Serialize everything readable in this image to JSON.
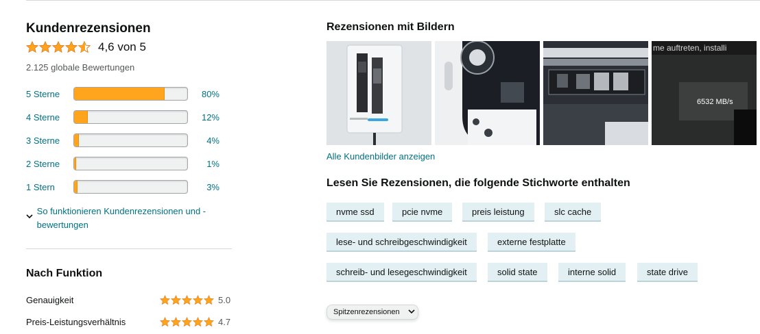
{
  "ratings": {
    "title": "Kundenrezensionen",
    "average_text": "4,6 von 5",
    "average_value": 4.6,
    "global_count": "2.125 globale Bewertungen",
    "histogram": [
      {
        "label": "5 Sterne",
        "percent": "80%",
        "value": 80
      },
      {
        "label": "4 Sterne",
        "percent": "12%",
        "value": 12
      },
      {
        "label": "3 Sterne",
        "percent": "4%",
        "value": 4
      },
      {
        "label": "2 Sterne",
        "percent": "1%",
        "value": 1
      },
      {
        "label": "1 Stern",
        "percent": "3%",
        "value": 3
      }
    ],
    "how_link": "So funktionieren Kundenrezensionen und -bewertungen"
  },
  "features": {
    "title": "Nach Funktion",
    "items": [
      {
        "label": "Genauigkeit",
        "value": "5.0"
      },
      {
        "label": "Preis-Leistungsverhältnis",
        "value": "4.7"
      }
    ]
  },
  "images": {
    "title": "Rezensionen mit Bildern",
    "photo4_caption": "6532 MB/s",
    "photo4_bg_text": "me auftreten, installi",
    "all_link": "Alle Kundenbilder anzeigen"
  },
  "keywords": {
    "title": "Lesen Sie Rezensionen, die folgende Stichworte enthalten",
    "chips": [
      "nvme ssd",
      "pcie nvme",
      "preis leistung",
      "slc cache",
      "lese- und schreibgeschwindigkeit",
      "externe festplatte",
      "schreib- und lesegeschwindigkeit",
      "solid state",
      "interne solid",
      "state drive"
    ]
  },
  "sort": {
    "selected": "Spitzenrezensionen"
  },
  "colors": {
    "star": "#ffa41c",
    "link": "#007185",
    "chip_bg": "#e3f0f3"
  }
}
